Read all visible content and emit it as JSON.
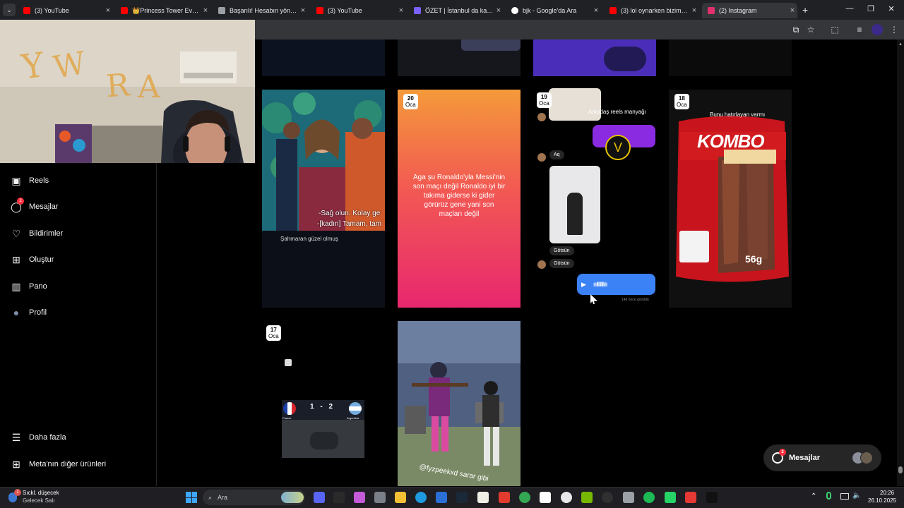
{
  "browser": {
    "tabs": [
      {
        "title": "(3) YouTube",
        "icon": "youtube-icon",
        "color": "#ff0000",
        "active": false
      },
      {
        "title": "👑Princess Tower Evolutio",
        "icon": "youtube-icon",
        "color": "#ff0000",
        "active": false
      },
      {
        "title": "Başarılı! Hesabın yöntem",
        "icon": "globe-icon",
        "color": "#9aa0a6",
        "active": false
      },
      {
        "title": "(3) YouTube",
        "icon": "youtube-icon",
        "color": "#ff0000",
        "active": false
      },
      {
        "title": "ÖZET | İstanbul da kazana",
        "icon": "ozet-icon",
        "color": "#7b61ff",
        "active": false
      },
      {
        "title": "bjk - Google'da Ara",
        "icon": "google-icon",
        "color": "#ffffff",
        "active": false
      },
      {
        "title": "(3) lol oynarken bizim me",
        "icon": "youtube-icon",
        "color": "#ff0000",
        "active": false
      },
      {
        "title": "(2) Instagram",
        "icon": "instagram-icon",
        "color": "#e1306c",
        "active": true
      }
    ],
    "new_tab": "+",
    "close": "×"
  },
  "sidebar": {
    "items": [
      {
        "label": "Reels",
        "icon": "reels-icon"
      },
      {
        "label": "Mesajlar",
        "icon": "messenger-icon",
        "badge": "2"
      },
      {
        "label": "Bildirimler",
        "icon": "heart-icon"
      },
      {
        "label": "Oluştur",
        "icon": "plus-square-icon"
      },
      {
        "label": "Pano",
        "icon": "chart-icon"
      },
      {
        "label": "Profil",
        "icon": "avatar-icon"
      }
    ],
    "bottom": [
      {
        "label": "Daha fazla",
        "icon": "menu-icon"
      },
      {
        "label": "Meta'nın diğer ürünleri",
        "icon": "apps-icon"
      }
    ]
  },
  "posts": [
    {
      "caption": "Şahmaran güzel olmuş",
      "subtitle1": "-Sağ olun. Kolay ge",
      "subtitle2": "-[kadın] Tamam, tam"
    },
    {
      "day": "20",
      "month": "Oca",
      "text": "Aga şu Ronaldo'yla Messi'nin son maçı değil Ronaldo iyi bir takıma giderse ki gider görürüz gene yani son maçları değil"
    },
    {
      "day": "19",
      "month": "Oca",
      "caption": "Arkadaş reels manyağı",
      "msg1": "Aq",
      "msg2": "Götsün",
      "msg3": "Götsün",
      "footer": "14d önce görüldü"
    },
    {
      "day": "18",
      "month": "Oca",
      "caption": "Bunu hatırlayan varmı",
      "brand": "KOMBO",
      "weight": "56g"
    },
    {
      "day": "17",
      "month": "Oca",
      "score": "1 - 2",
      "team1": "France",
      "team2": "Argentina"
    },
    {
      "caption": "@fyzpeekxd sarar gibi"
    }
  ],
  "messages_pill": {
    "label": "Mesajlar",
    "badge": "2"
  },
  "taskbar": {
    "weather_title": "Sıckl. düşecek",
    "weather_sub": "Gelecek Salı",
    "weather_badge": "1",
    "search_placeholder": "Ara",
    "time": "20:26",
    "date": "26.10.2025"
  }
}
